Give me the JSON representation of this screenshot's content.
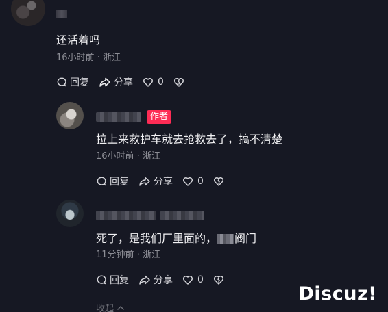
{
  "comments": [
    {
      "text": "还活着吗",
      "meta": "16小时前 · 浙江",
      "reply_label": "回复",
      "share_label": "分享",
      "likes": "0"
    },
    {
      "badge": "作者",
      "text": "拉上来救护车就去抢救去了，搞不清楚",
      "meta": "16小时前 · 浙江",
      "reply_label": "回复",
      "share_label": "分享",
      "likes": "0"
    },
    {
      "text_before": "死了，是我们厂里面的，",
      "text_after": "阀门",
      "meta": "11分钟前 · 浙江",
      "reply_label": "回复",
      "share_label": "分享",
      "likes": "0"
    }
  ],
  "collapse_label": "收起",
  "watermark": "Discuz!",
  "icons": [
    "comment-icon",
    "share-icon",
    "heart-icon",
    "dislike-icon",
    "chevron-up-icon"
  ],
  "colors": {
    "background": "#161823",
    "author_badge": "#fe2c55",
    "meta_text": "#8d8e96"
  }
}
